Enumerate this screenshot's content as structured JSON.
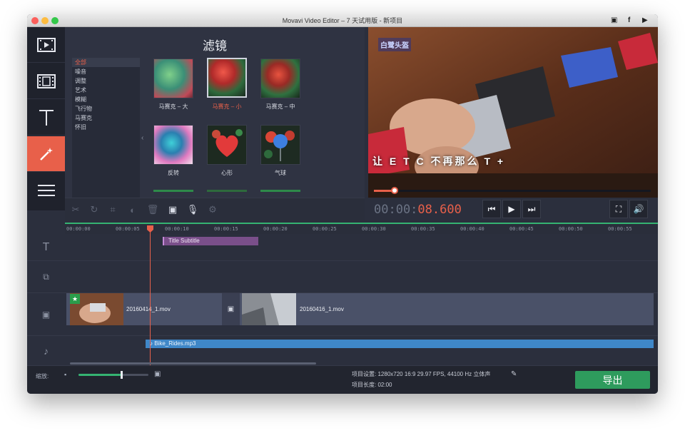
{
  "window": {
    "title": "Movavi Video Editor – 7 天试用版 - 新项目"
  },
  "titlebar_icons": [
    "screen-share-icon",
    "facebook-icon",
    "youtube-icon"
  ],
  "sidebar": {
    "items": [
      {
        "name": "media-import",
        "icon": "film-import-icon"
      },
      {
        "name": "media-library",
        "icon": "film-strip-icon"
      },
      {
        "name": "titles",
        "icon": "text-t-icon"
      },
      {
        "name": "filters",
        "icon": "magic-wand-icon",
        "active": true
      },
      {
        "name": "more",
        "icon": "hamburger-menu-icon"
      }
    ]
  },
  "filters": {
    "title": "滤镜",
    "categories": [
      "全部",
      "噪音",
      "调整",
      "艺术",
      "模糊",
      "飞行物",
      "马赛克",
      "怀旧"
    ],
    "selected_category": "全部",
    "thumbnails": [
      {
        "label": "马赛克 – 大",
        "selected": false
      },
      {
        "label": "马赛克 – 小",
        "selected": true
      },
      {
        "label": "马赛克 – 中",
        "selected": false
      },
      {
        "label": "反转",
        "selected": false
      },
      {
        "label": "心形",
        "selected": false
      },
      {
        "label": "气球",
        "selected": false
      }
    ]
  },
  "toolbar": {
    "tools": [
      {
        "name": "cut-icon",
        "glyph": "✂",
        "enabled": false
      },
      {
        "name": "rotate-icon",
        "glyph": "↻",
        "enabled": false
      },
      {
        "name": "crop-icon",
        "glyph": "⌗",
        "enabled": false
      },
      {
        "name": "color-adjust-icon",
        "glyph": "◐",
        "enabled": false
      },
      {
        "name": "delete-icon",
        "glyph": "🗑",
        "enabled": false
      },
      {
        "name": "image-icon",
        "glyph": "▣",
        "enabled": true
      },
      {
        "name": "microphone-icon",
        "glyph": "🎙",
        "enabled": true
      },
      {
        "name": "settings-icon",
        "glyph": "⚙",
        "enabled": false
      }
    ]
  },
  "preview": {
    "overlay_text": "白鹭头盔",
    "subtitle_text": "让 E T C 不再那么 T +",
    "timecode_prefix": "00:00:",
    "timecode_active": "08.600",
    "progress": 0.06
  },
  "playback": {
    "prev": "⏮",
    "play": "▶",
    "next": "⏭",
    "fullscreen": "⛶",
    "volume": "🔊"
  },
  "timeline": {
    "ticks": [
      "00:00:00",
      "00:00:05",
      "00:00:10",
      "00:00:15",
      "00:00:20",
      "00:00:25",
      "00:00:30",
      "00:00:35",
      "00:00:40",
      "00:00:45",
      "00:00:50",
      "00:00:55"
    ],
    "title_clip": "Title Subtitle",
    "video_clips": [
      "20160414_1.mov",
      "20160416_1.mov"
    ],
    "audio_clip": "Bike_Rides.mp3",
    "track_icons": [
      "title-track-icon",
      "overlay-track-icon",
      "video-track-icon",
      "audio-track-icon"
    ]
  },
  "bottom": {
    "zoom_label": "缩放:",
    "zoom_level": 0.6,
    "project_settings_label": "项目设置:",
    "project_settings_value": "1280x720 16:9 29.97 FPS, 44100 Hz 立体声",
    "project_length_label": "项目长度:",
    "project_length_value": "02:00",
    "export_label": "导出"
  },
  "colors": {
    "accent": "#e8604a",
    "export": "#2e9b5d",
    "title_clip": "#7a4f8a",
    "audio_clip": "#3f87c8",
    "timeline_line": "#35b372"
  }
}
